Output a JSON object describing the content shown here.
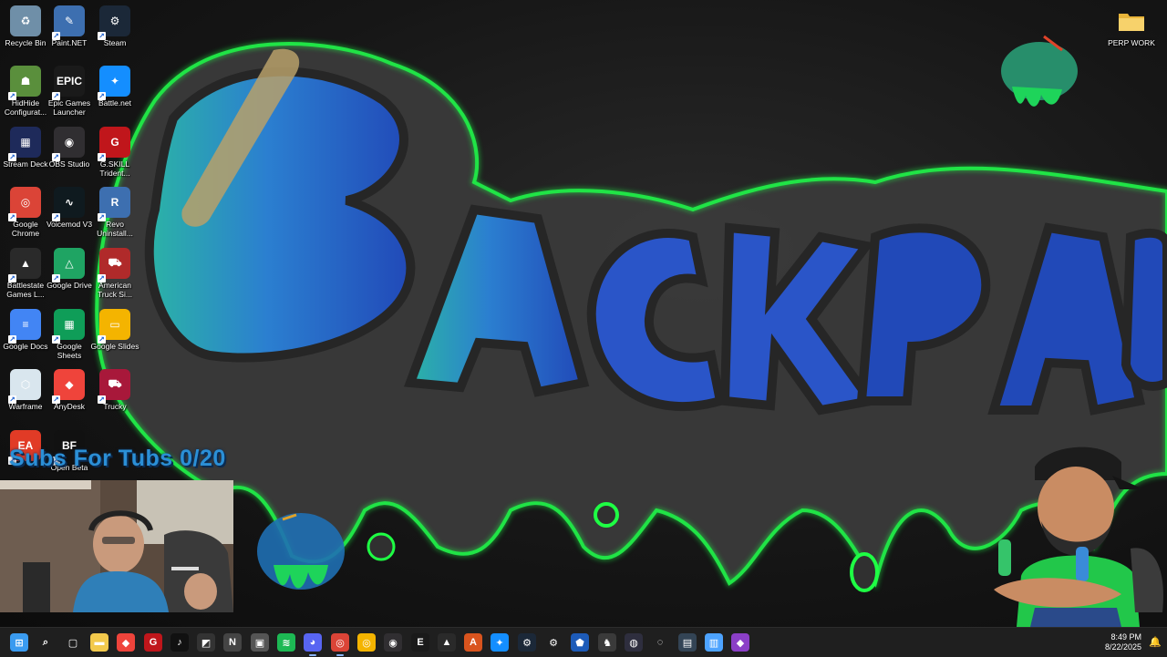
{
  "desktop_icons": [
    {
      "label": "Recycle Bin",
      "icon": "recycle-bin-icon",
      "color": "#6f8fa8",
      "glyph": "♻",
      "shortcut": false
    },
    {
      "label": "Paint.NET",
      "icon": "paint-net-icon",
      "color": "#3d6fb0",
      "glyph": "✎",
      "shortcut": true
    },
    {
      "label": "Steam",
      "icon": "steam-icon",
      "color": "#1b2838",
      "glyph": "⚙",
      "shortcut": true
    },
    {
      "label": "HidHide Configurat...",
      "icon": "hidhide-icon",
      "color": "#5a8f3c",
      "glyph": "☗",
      "shortcut": true
    },
    {
      "label": "Epic Games Launcher",
      "icon": "epic-games-icon",
      "color": "#1a1a1a",
      "glyph": "EPIC",
      "shortcut": true
    },
    {
      "label": "Battle.net",
      "icon": "battle-net-icon",
      "color": "#148eff",
      "glyph": "✦",
      "shortcut": true
    },
    {
      "label": "Stream Deck",
      "icon": "stream-deck-icon",
      "color": "#1e2a5a",
      "glyph": "▦",
      "shortcut": true
    },
    {
      "label": "OBS Studio",
      "icon": "obs-studio-icon",
      "color": "#302e31",
      "glyph": "◉",
      "shortcut": true
    },
    {
      "label": "G.SKILL Trident...",
      "icon": "gskill-icon",
      "color": "#c0161b",
      "glyph": "G",
      "shortcut": true
    },
    {
      "label": "Google Chrome",
      "icon": "google-chrome-icon",
      "color": "#db4437",
      "glyph": "◎",
      "shortcut": true
    },
    {
      "label": "Voicemod V3",
      "icon": "voicemod-icon",
      "color": "#0f1a1f",
      "glyph": "∿",
      "shortcut": true
    },
    {
      "label": "Revo Uninstall...",
      "icon": "revo-uninstaller-icon",
      "color": "#3d6fb0",
      "glyph": "R",
      "shortcut": true
    },
    {
      "label": "Battlestate Games L...",
      "icon": "battlestate-icon",
      "color": "#2a2a2a",
      "glyph": "▲",
      "shortcut": true
    },
    {
      "label": "Google Drive",
      "icon": "google-drive-icon",
      "color": "#1fa463",
      "glyph": "△",
      "shortcut": true
    },
    {
      "label": "American Truck Si...",
      "icon": "american-truck-icon",
      "color": "#b02a2a",
      "glyph": "⛟",
      "shortcut": true
    },
    {
      "label": "Google Docs",
      "icon": "google-docs-icon",
      "color": "#4285f4",
      "glyph": "≡",
      "shortcut": true
    },
    {
      "label": "Google Sheets",
      "icon": "google-sheets-icon",
      "color": "#0f9d58",
      "glyph": "▦",
      "shortcut": true
    },
    {
      "label": "Google Slides",
      "icon": "google-slides-icon",
      "color": "#f4b400",
      "glyph": "▭",
      "shortcut": true
    },
    {
      "label": "Warframe",
      "icon": "warframe-icon",
      "color": "#d9e6ee",
      "glyph": "⬡",
      "shortcut": true
    },
    {
      "label": "AnyDesk",
      "icon": "anydesk-icon",
      "color": "#ef443b",
      "glyph": "◆",
      "shortcut": true
    },
    {
      "label": "Trucky",
      "icon": "trucky-icon",
      "color": "#a8183a",
      "glyph": "⛟",
      "shortcut": true
    },
    {
      "label": "",
      "icon": "ea-app-icon",
      "color": "#e13b26",
      "glyph": "EA",
      "shortcut": true
    },
    {
      "label": "Open Beta",
      "icon": "battlefield-icon",
      "color": "#111111",
      "glyph": "BF",
      "shortcut": true
    }
  ],
  "folder_icon": {
    "label": "PERP WORK",
    "icon": "folder-icon",
    "color": "#f2c94c"
  },
  "overlay": {
    "subs_goal": "Subs For Tubs 0/20"
  },
  "taskbar": {
    "items": [
      {
        "icon": "windows-start-icon",
        "color": "#3a9bf0",
        "glyph": "⊞",
        "active": false
      },
      {
        "icon": "search-icon",
        "color": "transparent",
        "glyph": "⌕",
        "active": false
      },
      {
        "icon": "task-view-icon",
        "color": "transparent",
        "glyph": "▢",
        "active": false
      },
      {
        "icon": "file-explorer-icon",
        "color": "#f2c94c",
        "glyph": "▬",
        "active": false
      },
      {
        "icon": "anydesk-icon",
        "color": "#ef443b",
        "glyph": "◆",
        "active": false
      },
      {
        "icon": "gskill-icon",
        "color": "#c0161b",
        "glyph": "G",
        "active": false
      },
      {
        "icon": "tiktok-icon",
        "color": "#111111",
        "glyph": "♪",
        "active": false
      },
      {
        "icon": "cursor-app-icon",
        "color": "#333333",
        "glyph": "◩",
        "active": false
      },
      {
        "icon": "notepad-plus-icon",
        "color": "#444444",
        "glyph": "N",
        "active": false
      },
      {
        "icon": "photo-app-icon",
        "color": "#555555",
        "glyph": "▣",
        "active": false
      },
      {
        "icon": "spotify-icon",
        "color": "#1db954",
        "glyph": "≋",
        "active": false
      },
      {
        "icon": "discord-icon",
        "color": "#5865f2",
        "glyph": "◕",
        "active": true
      },
      {
        "icon": "google-chrome-icon",
        "color": "#db4437",
        "glyph": "◎",
        "active": true
      },
      {
        "icon": "google-chrome-icon",
        "color": "#f4b400",
        "glyph": "◎",
        "active": false
      },
      {
        "icon": "obs-studio-icon",
        "color": "#302e31",
        "glyph": "◉",
        "active": false
      },
      {
        "icon": "epic-games-icon",
        "color": "#1a1a1a",
        "glyph": "E",
        "active": false
      },
      {
        "icon": "battlestate-icon",
        "color": "#2a2a2a",
        "glyph": "▲",
        "active": false
      },
      {
        "icon": "ark-icon",
        "color": "#d9541e",
        "glyph": "A",
        "active": false
      },
      {
        "icon": "battle-net-icon",
        "color": "#148eff",
        "glyph": "✦",
        "active": false
      },
      {
        "icon": "steam-icon",
        "color": "#1b2838",
        "glyph": "⚙",
        "active": false
      },
      {
        "icon": "gear-icon",
        "color": "transparent",
        "glyph": "⚙",
        "active": false
      },
      {
        "icon": "rocket-league-icon",
        "color": "#1d5bb8",
        "glyph": "⬟",
        "active": false
      },
      {
        "icon": "game-shield-icon",
        "color": "#3a3a3a",
        "glyph": "♞",
        "active": false
      },
      {
        "icon": "controller-icon",
        "color": "#2e2e3e",
        "glyph": "◍",
        "active": false
      },
      {
        "icon": "compass-icon",
        "color": "transparent",
        "glyph": "◌",
        "active": false
      },
      {
        "icon": "game-card-icon",
        "color": "#334455",
        "glyph": "▤",
        "active": false
      },
      {
        "icon": "notepad-icon",
        "color": "#4da3ff",
        "glyph": "▥",
        "active": false
      },
      {
        "icon": "purple-app-icon",
        "color": "#8b3fc7",
        "glyph": "◆",
        "active": false
      }
    ],
    "time": "8:49 PM",
    "date": "8/22/2025"
  }
}
